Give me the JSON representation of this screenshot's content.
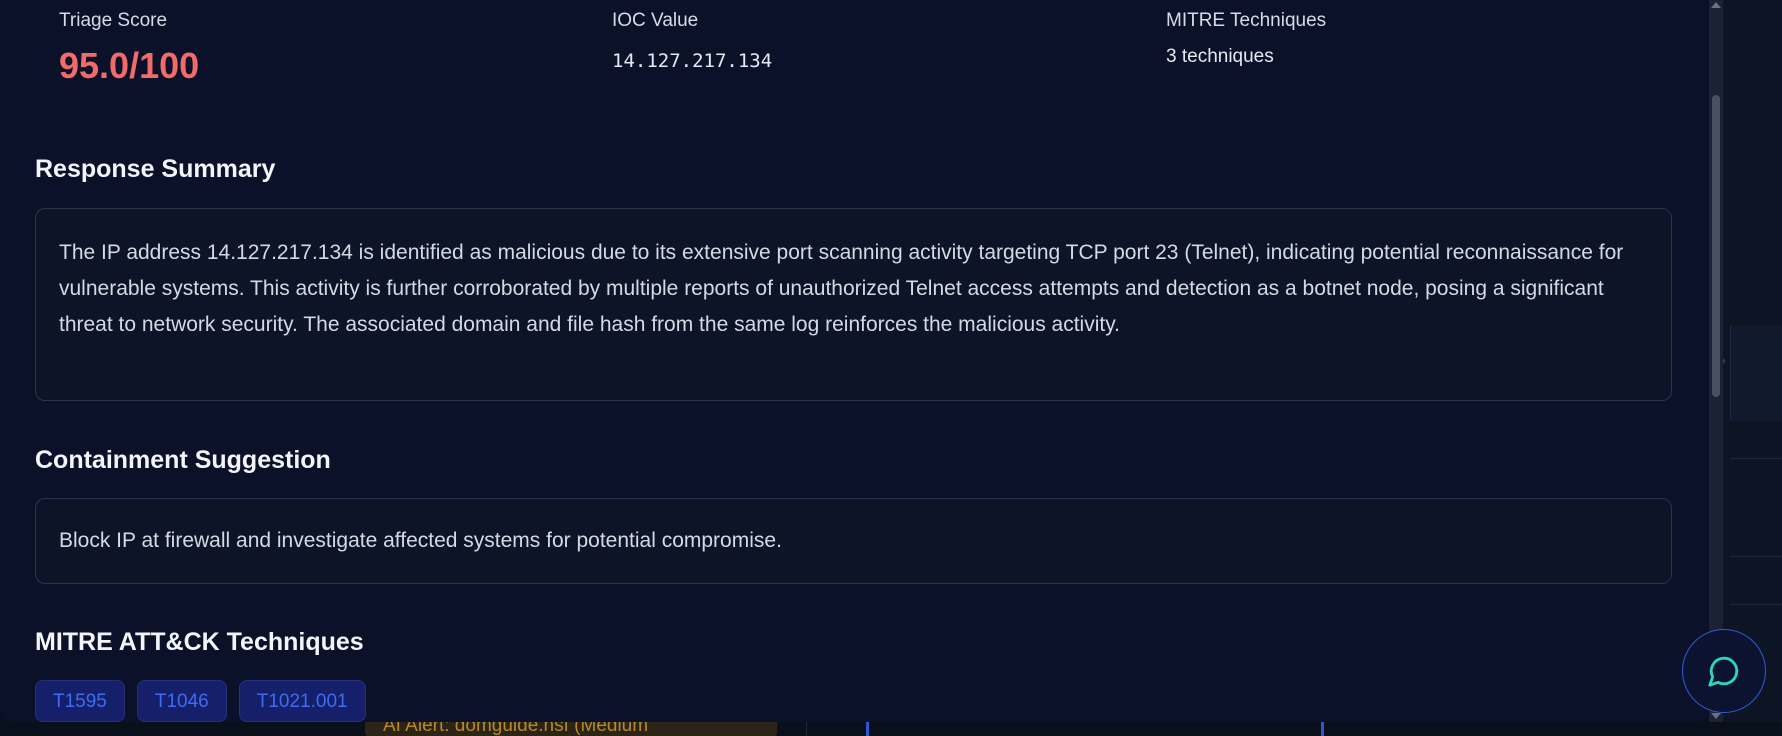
{
  "background": {
    "alert_text": "AI Alert: domguide.nsf (Medium"
  },
  "meta": {
    "triage_label": "Triage Score",
    "triage_value": "95.0/100",
    "ioc_label": "IOC Value",
    "ioc_value": "14.127.217.134",
    "mitre_label": "MITRE Techniques",
    "mitre_value": "3 techniques"
  },
  "response": {
    "title": "Response Summary",
    "text": "The IP address 14.127.217.134 is identified as malicious due to its extensive port scanning activity targeting TCP port 23 (Telnet), indicating potential reconnaissance for vulnerable systems. This activity is further corroborated by multiple reports of unauthorized Telnet access attempts and detection as a botnet node, posing a significant threat to network security. The associated domain and file hash from the same log reinforces the malicious activity."
  },
  "containment": {
    "title": "Containment Suggestion",
    "text": "Block IP at firewall and investigate affected systems for potential compromise."
  },
  "mitre": {
    "title": "MITRE ATT&CK Techniques",
    "tags": [
      "T1595",
      "T1046",
      "T1021.001"
    ]
  },
  "colors": {
    "score": "#f26b6b",
    "tag_text": "#3d6cf2",
    "tag_bg": "#16206a",
    "chat_accent": "#2dd4bf"
  },
  "icons": {
    "chat": "chat-bubble-icon",
    "panel_chevron": "chevron-right-icon"
  }
}
